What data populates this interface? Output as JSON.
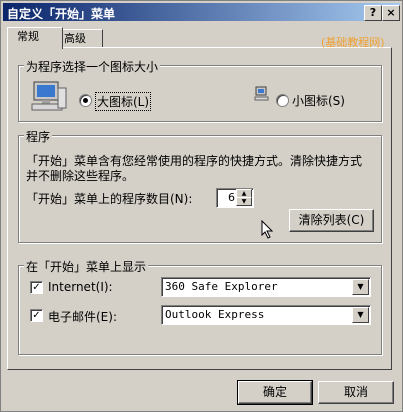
{
  "window": {
    "title": "自定义「开始」菜单",
    "help_button": "?",
    "close_button": "×"
  },
  "tabs": [
    {
      "label": "常规",
      "active": true
    },
    {
      "label": "高级",
      "active": false
    }
  ],
  "watermark": "(基础教程网)",
  "icon_size_group": {
    "title": "为程序选择一个图标大小",
    "large_label": "大图标(L)",
    "small_label": "小图标(S)",
    "selected": "large"
  },
  "programs_group": {
    "title": "程序",
    "description_line1": "「开始」菜单含有您经常使用的程序的快捷方式。清除快捷方式",
    "description_line2": "并不删除这些程序。",
    "count_label": "「开始」菜单上的程序数目(N):",
    "count_value": "6",
    "clear_button": "清除列表(C)"
  },
  "show_group": {
    "title": "在「开始」菜单上显示",
    "internet_label": "Internet(I):",
    "internet_checked": true,
    "internet_value": "360 Safe Explorer",
    "email_label": "电子邮件(E):",
    "email_checked": true,
    "email_value": "Outlook Express"
  },
  "footer": {
    "ok_label": "确定",
    "cancel_label": "取消"
  },
  "colors": {
    "titlebar_start": "#0a246a",
    "titlebar_end": "#a6caf0",
    "face": "#d4d0c8",
    "watermark": "#f0a030"
  }
}
